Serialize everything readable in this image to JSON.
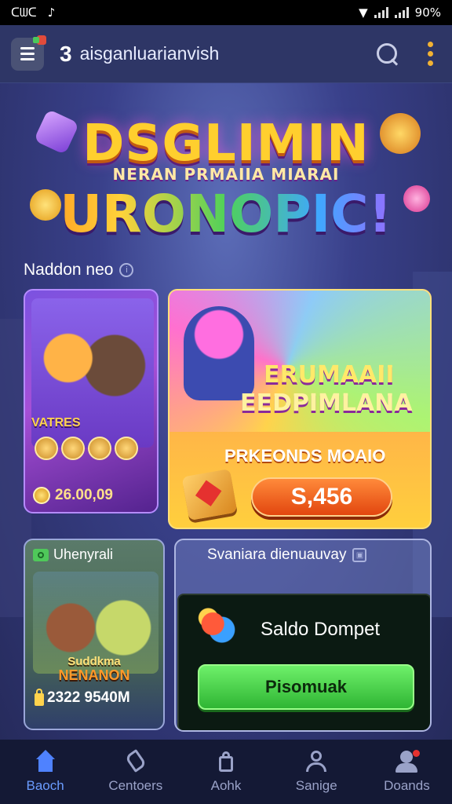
{
  "status_bar": {
    "carrier": "ᑕᗯᑕ",
    "app_icon": "tiktok-icon",
    "battery": "90%"
  },
  "header": {
    "badge_number": "3",
    "title": "aisganluarianvish"
  },
  "banner": {
    "line1": "DSGLIMIN",
    "line2": "NERAN PRMAIIA MIARAI",
    "line3": "URONOPIC!"
  },
  "section": {
    "label": "Naddon neo"
  },
  "card_characters": {
    "tag": "VATRES",
    "amount": "26.00,09"
  },
  "card_promo": {
    "title1": "ERUMAAII",
    "title2": "EEDPIMLANA",
    "subtitle": "PRKEONDS MOAIO",
    "price": "S,456"
  },
  "card_bottom_left": {
    "heading": "Uhenyrali",
    "text1": "Suddkma",
    "text2": "NENANON",
    "amount": "2322 9540M"
  },
  "card_wallet": {
    "heading": "Svaniara dienuauvay",
    "wallet_label": "Saldo Dompet",
    "button_label": "Pisomuak"
  },
  "bottom_nav": [
    {
      "label": "Baoch",
      "icon": "home-icon",
      "active": true
    },
    {
      "label": "Centoers",
      "icon": "phone-icon",
      "active": false
    },
    {
      "label": "Aohk",
      "icon": "shopping-bag-icon",
      "active": false
    },
    {
      "label": "Sanige",
      "icon": "user-icon",
      "active": false
    },
    {
      "label": "Doands",
      "icon": "group-icon",
      "active": false
    }
  ],
  "colors": {
    "accent": "#6b9cff",
    "primary_button": "#2fb534",
    "price_button": "#e2460f"
  }
}
